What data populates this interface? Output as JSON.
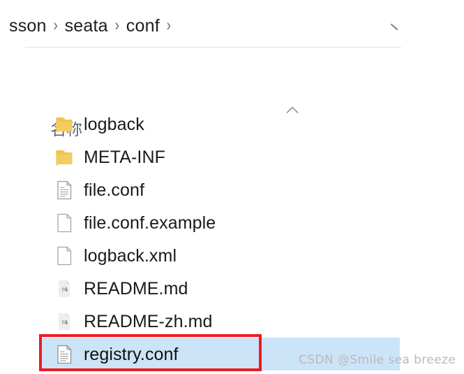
{
  "breadcrumb": {
    "name": "address-breadcrumb",
    "separator": "›",
    "crumbs": [
      {
        "label": "sson",
        "clipped": true
      },
      {
        "label": "seata",
        "clipped": false
      },
      {
        "label": "conf",
        "clipped": false
      }
    ],
    "trailing_separator": "›",
    "dropdown_icon": "chevron-down-icon"
  },
  "column_header": {
    "name_label": "名称",
    "sort_icon": "sort-ascending-caret-icon",
    "sort_direction": "ascending"
  },
  "file_list": {
    "items": [
      {
        "label": "logback",
        "icon": "folder-icon",
        "type": "folder",
        "selected": false
      },
      {
        "label": "META-INF",
        "icon": "folder-icon",
        "type": "folder",
        "selected": false
      },
      {
        "label": "file.conf",
        "icon": "document-lines-icon",
        "type": "file",
        "selected": false
      },
      {
        "label": "file.conf.example",
        "icon": "blank-page-icon",
        "type": "file",
        "selected": false
      },
      {
        "label": "logback.xml",
        "icon": "blank-page-icon",
        "type": "file",
        "selected": false
      },
      {
        "label": "README.md",
        "icon": "markdown-file-icon",
        "type": "file",
        "selected": false
      },
      {
        "label": "README-zh.md",
        "icon": "markdown-file-icon",
        "type": "file",
        "selected": false
      },
      {
        "label": "registry.conf",
        "icon": "document-lines-icon",
        "type": "file",
        "selected": true
      }
    ]
  },
  "annotation": {
    "name": "red-highlight-rectangle",
    "color": "#ee1b22",
    "target": "registry.conf"
  },
  "watermark": {
    "text": "CSDN @Smile sea breeze",
    "color": "#b9b9bd"
  },
  "colors": {
    "selection": "#cce4f7",
    "folder": "#f3cd5f",
    "header_text": "#5d6475",
    "item_text": "#1a1a1a"
  }
}
